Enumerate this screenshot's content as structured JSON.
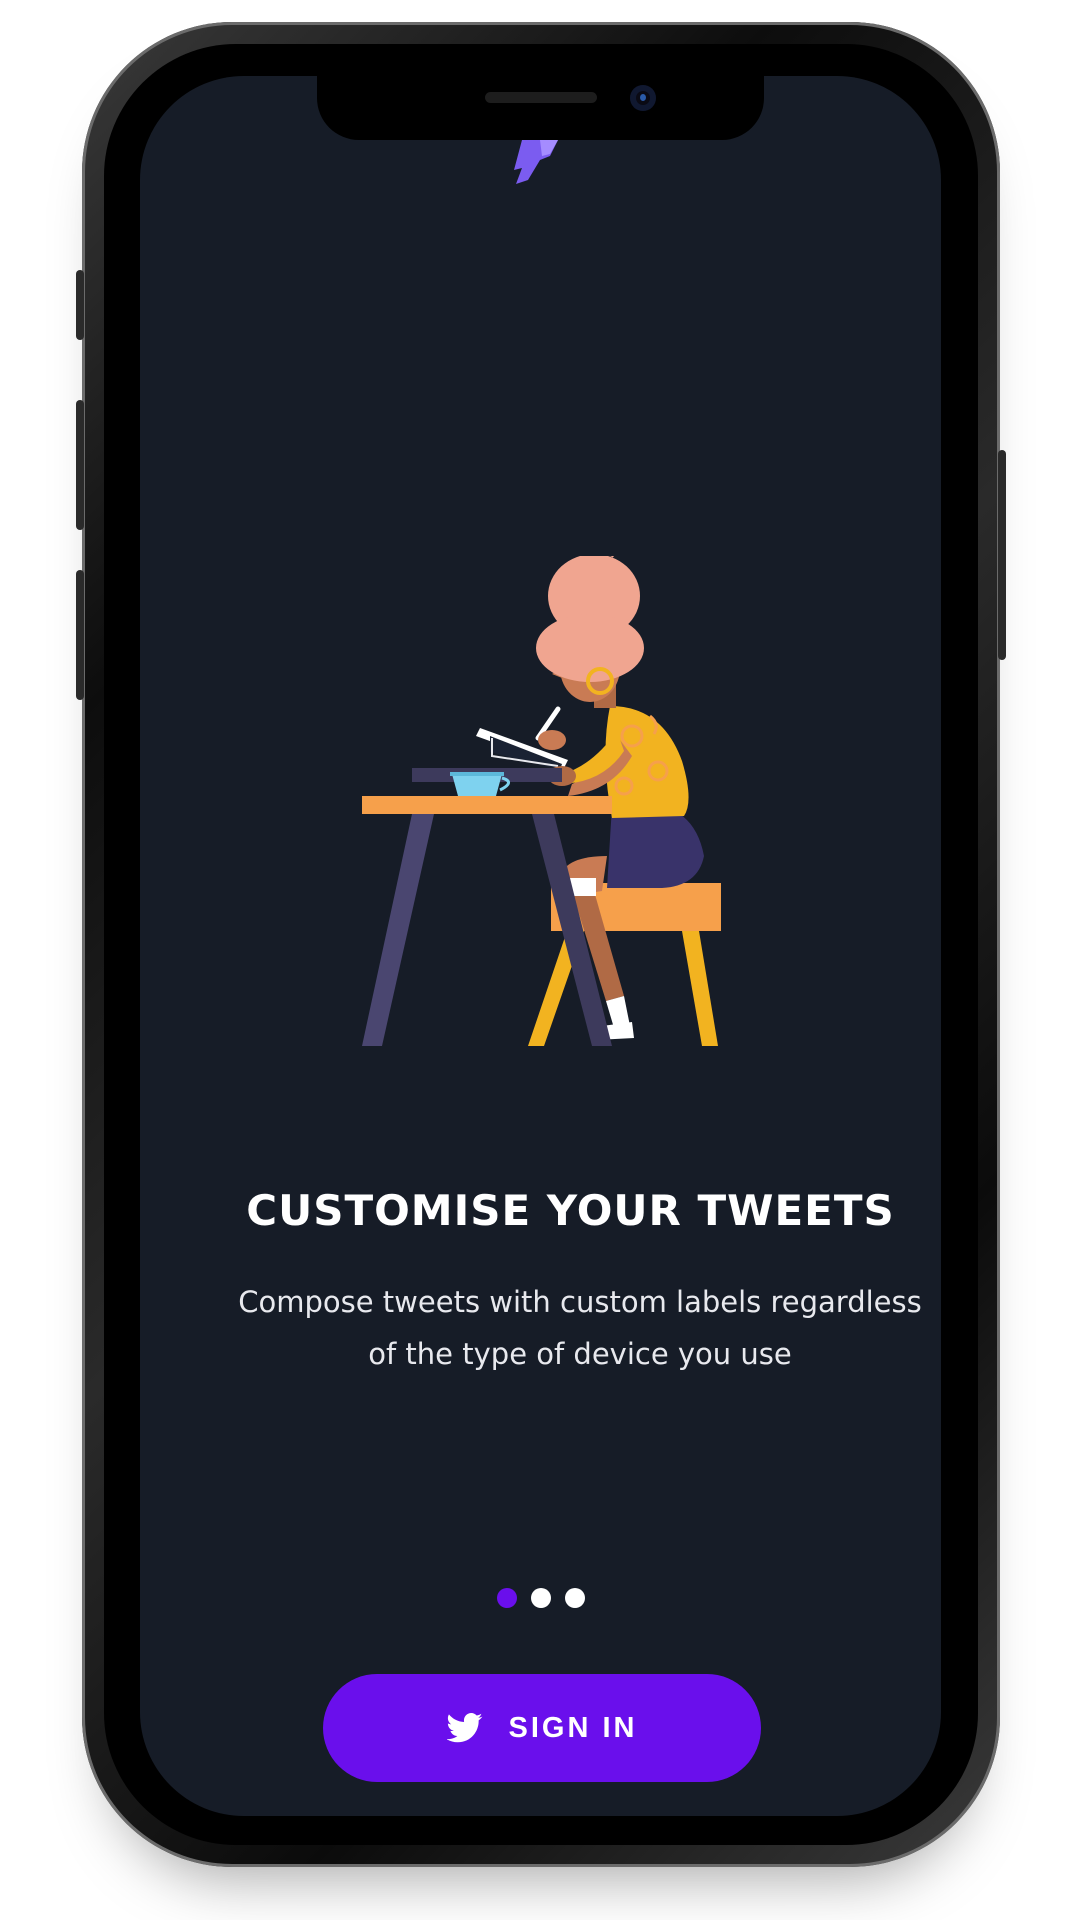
{
  "onboarding": {
    "title": "CUSTOMISE YOUR TWEETS",
    "subtitle": "Compose tweets with custom labels regardless of the type of device you use",
    "pagination": {
      "total": 3,
      "active": 1
    }
  },
  "signin_button": {
    "label": "SIGN IN",
    "icon": "twitter-bird-icon"
  },
  "colors": {
    "background": "#161c27",
    "accent": "#6a0fec",
    "text": "#ffffff",
    "subtext": "#e8e9ee"
  }
}
